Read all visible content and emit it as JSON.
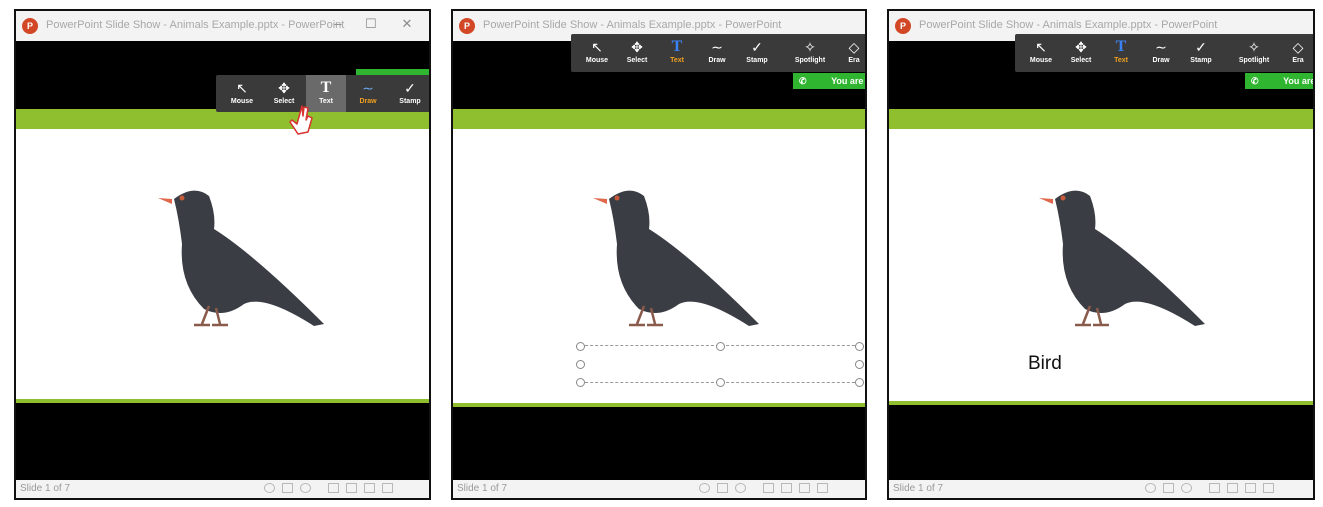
{
  "app": {
    "title": "PowerPoint Slide Show  -  Animals Example.pptx  -  PowerPoint",
    "icon": "powerpoint-icon",
    "icon_letter": "P",
    "status": "Slide 1 of 7",
    "window_controls": [
      "–",
      "☐",
      "✕"
    ]
  },
  "toolbar": {
    "tools": [
      {
        "label": "Mouse",
        "icon": "cursor-icon",
        "glyph": "↖"
      },
      {
        "label": "Select",
        "icon": "move-icon",
        "glyph": "✥"
      },
      {
        "label": "Text",
        "icon": "text-icon",
        "glyph": "T"
      },
      {
        "label": "Draw",
        "icon": "squiggle-icon",
        "glyph": "∼"
      },
      {
        "label": "Stamp",
        "icon": "checkmark-icon",
        "glyph": "✓"
      },
      {
        "label": "Spotlight",
        "icon": "wand-icon",
        "glyph": "✧"
      },
      {
        "label": "Era",
        "icon": "eraser-icon",
        "glyph": "◇"
      }
    ]
  },
  "share_banner": {
    "text": "You are"
  },
  "annotation": {
    "text": "Bird"
  },
  "colors": {
    "accent_green": "#8fbf2f",
    "toolbar_bg": "#3a3a3a",
    "share_green": "#2fb52f",
    "draw_orange": "#f0a020",
    "text_blue": "#3b82f6"
  }
}
